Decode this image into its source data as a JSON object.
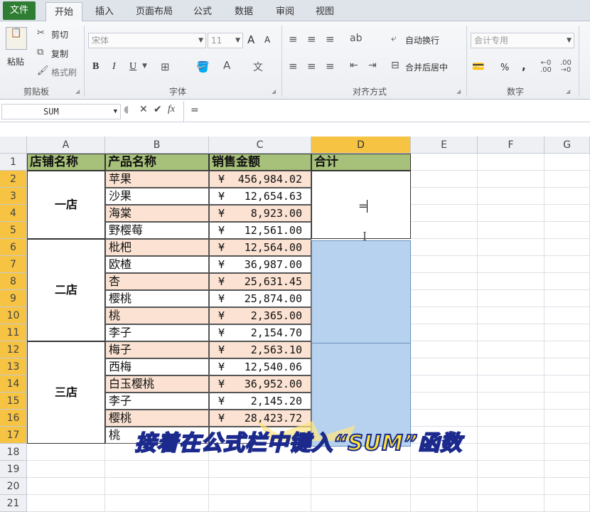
{
  "tabs": [
    "文件",
    "开始",
    "插入",
    "页面布局",
    "公式",
    "数据",
    "审阅",
    "视图"
  ],
  "ribbon": {
    "paste": "粘贴",
    "cut": "剪切",
    "copy": "复制",
    "format_painter": "格式刷",
    "font_name": "宋体",
    "font_size": "11",
    "wrap_text": "自动换行",
    "merge_center": "合并后居中",
    "number_format": "会计专用",
    "bold": "B",
    "italic": "I",
    "underline": "U",
    "percent": "%",
    "comma": ",",
    "font_grow": "A",
    "font_shrink": "A",
    "groups": [
      "剪贴板",
      "字体",
      "对齐方式",
      "数字"
    ]
  },
  "formula_bar": {
    "name_box": "SUM",
    "fx": "fx",
    "formula": "="
  },
  "columns": [
    "A",
    "B",
    "C",
    "D",
    "E",
    "F",
    "G"
  ],
  "rows": [
    "1",
    "2",
    "3",
    "4",
    "5",
    "6",
    "7",
    "8",
    "9",
    "10",
    "11",
    "12",
    "13",
    "14",
    "15",
    "16",
    "17",
    "18",
    "19",
    "20",
    "21"
  ],
  "headers": {
    "store": "店铺名称",
    "product": "产品名称",
    "amount": "销售金额",
    "total": "合计"
  },
  "stores": [
    "一店",
    "二店",
    "三店"
  ],
  "products": [
    "苹果",
    "沙果",
    "海棠",
    "野樱莓",
    "枇杷",
    "欧楂",
    "杏",
    "樱桃",
    "桃",
    "李子",
    "梅子",
    "西梅",
    "白玉樱桃",
    "李子",
    "樱桃",
    "桃"
  ],
  "amounts": [
    "456,984.02",
    "12,654.63",
    "8,923.00",
    "12,561.00",
    "12,564.00",
    "36,987.00",
    "25,631.45",
    "25,874.00",
    "2,365.00",
    "2,154.70",
    "2,563.10",
    "12,540.06",
    "36,952.00",
    "2,145.20",
    "28,423.72",
    ""
  ],
  "currency": "¥",
  "d2_edit": "=",
  "banner": "接着在公式栏中键入“SUM”函数",
  "colors": {
    "header_green": "#a7c17a",
    "peach": "#fbe2d2",
    "selection_blue": "#b7d2ee",
    "active_header": "#f6c342",
    "file_tab": "#2f7d32"
  }
}
